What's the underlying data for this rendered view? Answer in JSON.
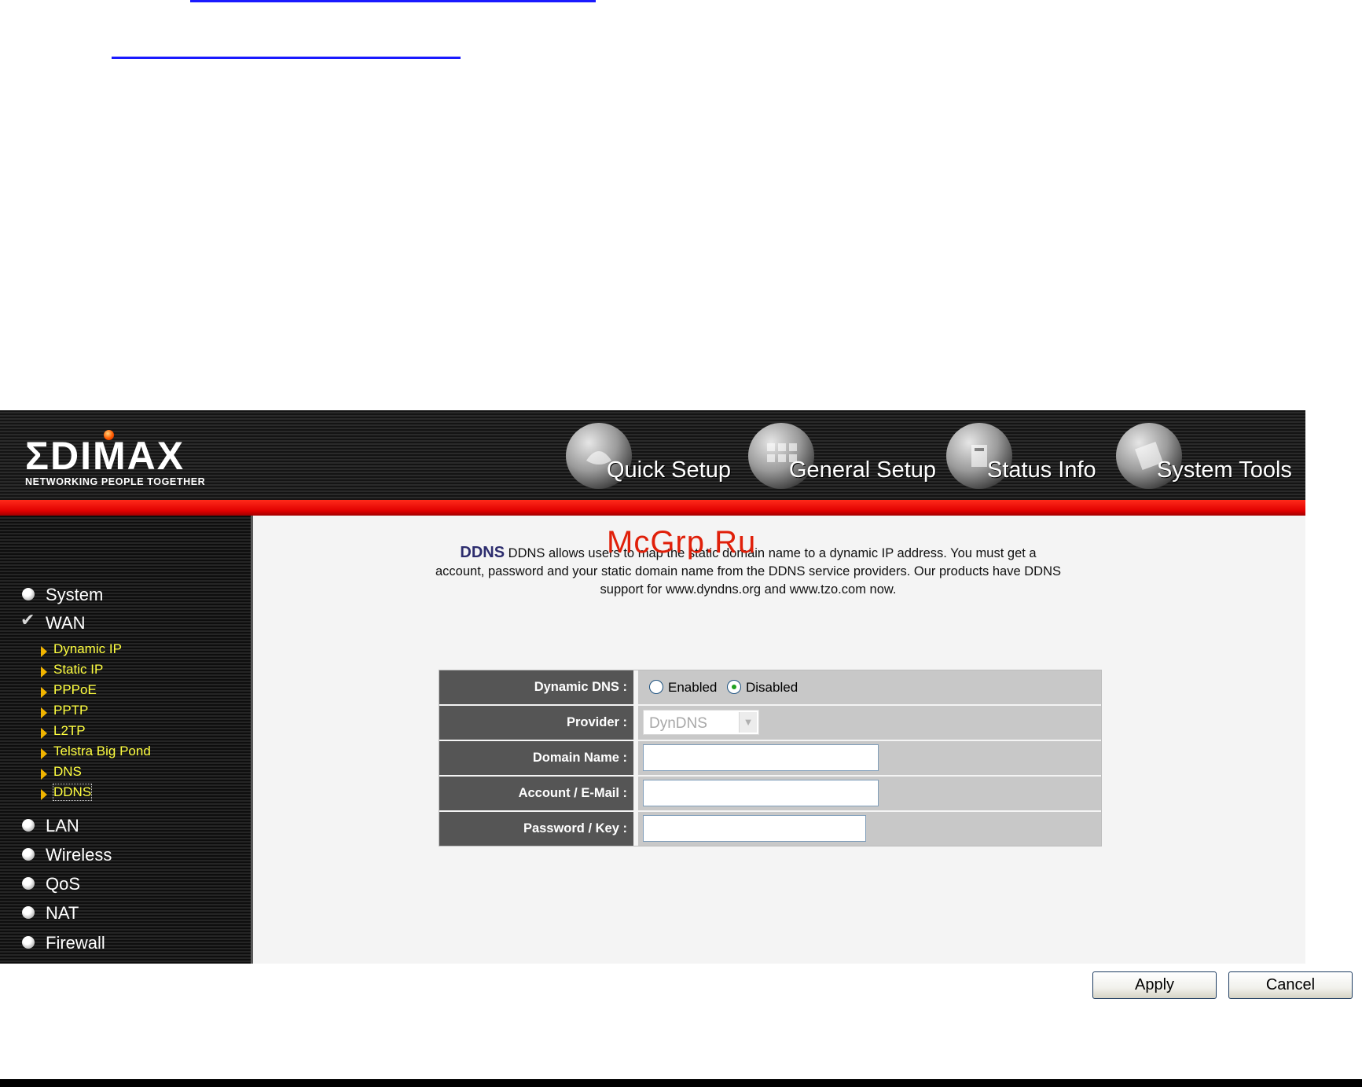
{
  "header": {
    "brand": "ΣDIMAX",
    "tagline": "NETWORKING PEOPLE TOGETHER",
    "nav": [
      {
        "label": "Quick Setup",
        "icon": "quick-setup-icon"
      },
      {
        "label": "General Setup",
        "icon": "general-setup-icon"
      },
      {
        "label": "Status Info",
        "icon": "status-info-icon"
      },
      {
        "label": "System Tools",
        "icon": "system-tools-icon"
      }
    ]
  },
  "sidebar": {
    "items": [
      {
        "label": "System"
      },
      {
        "label": "WAN"
      },
      {
        "label": "LAN"
      },
      {
        "label": "Wireless"
      },
      {
        "label": "QoS"
      },
      {
        "label": "NAT"
      },
      {
        "label": "Firewall"
      }
    ],
    "wan_sub": [
      {
        "label": "Dynamic IP"
      },
      {
        "label": "Static IP"
      },
      {
        "label": "PPPoE"
      },
      {
        "label": "PPTP"
      },
      {
        "label": "L2TP"
      },
      {
        "label": "Telstra Big Pond"
      },
      {
        "label": "DNS"
      },
      {
        "label": "DDNS"
      }
    ]
  },
  "main": {
    "intro_title": "DDNS",
    "intro_text": " DDNS allows users to map the static domain name to a dynamic IP address. You must get a account, password and your static domain name from the DDNS service providers. Our products have DDNS support for www.dyndns.org and www.tzo.com now.",
    "form": {
      "dynamic_dns_label": "Dynamic DNS :",
      "enabled_label": "Enabled",
      "disabled_label": "Disabled",
      "dynamic_dns_value": "Disabled",
      "provider_label": "Provider :",
      "provider_value": "DynDNS",
      "domain_label": "Domain Name :",
      "domain_value": "",
      "account_label": "Account / E-Mail :",
      "account_value": "",
      "password_label": "Password / Key :",
      "password_value": ""
    },
    "apply_label": "Apply",
    "cancel_label": "Cancel"
  },
  "watermark": "McGrp.Ru",
  "colors": {
    "accent_red": "#e00000",
    "sidebar_link": "#ffff40",
    "label_bg": "#555555",
    "value_bg": "#c8c8c8"
  }
}
